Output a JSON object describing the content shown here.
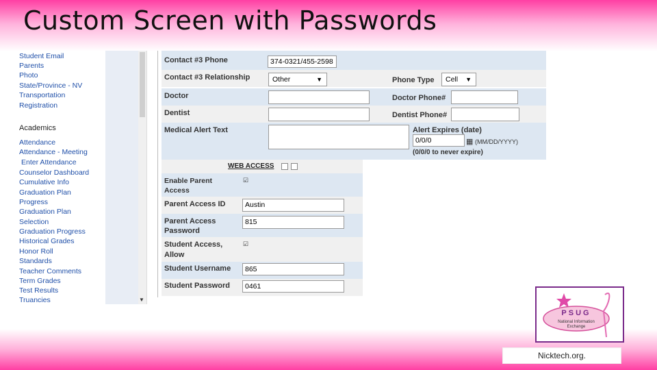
{
  "slide": {
    "title": "Custom Screen with Passwords",
    "footer": "Nicktech.org."
  },
  "nav": {
    "items_top": [
      "Student Email",
      "Parents",
      "Photo",
      "State/Province - NV",
      "Transportation",
      "Registration"
    ],
    "section": "Academics",
    "items": [
      "Attendance",
      "Attendance - Meeting",
      "Enter Attendance",
      "Counselor Dashboard",
      "Cumulative Info",
      "Graduation Plan",
      "Progress",
      "Graduation Plan",
      "Selection",
      "Graduation Progress",
      "Historical Grades",
      "Honor Roll",
      "Standards",
      "Teacher Comments",
      "Term Grades",
      "Test Results",
      "Truancies"
    ]
  },
  "form": {
    "contact3_phone": {
      "label": "Contact #3 Phone",
      "value": "374-0321/455-2598"
    },
    "contact3_rel": {
      "label": "Contact #3 Relationship",
      "value": "Other"
    },
    "phone_type": {
      "label": "Phone Type",
      "value": "Cell"
    },
    "doctor": {
      "label": "Doctor",
      "value": ""
    },
    "doctor_phone": {
      "label": "Doctor Phone#",
      "value": ""
    },
    "dentist": {
      "label": "Dentist",
      "value": ""
    },
    "dentist_phone": {
      "label": "Dentist Phone#",
      "value": ""
    },
    "medical_alert": {
      "label": "Medical Alert Text",
      "value": ""
    },
    "alert_expires": {
      "label": "Alert Expires (date)",
      "value": "0/0/0",
      "format": "(MM/DD/YYYY)",
      "hint": "(0/0/0 to never expire)"
    },
    "web_access": {
      "label": "WEB ACCESS"
    },
    "enable_parent": {
      "label1": "Enable Parent",
      "label2": "Access",
      "checked": true
    },
    "parent_id": {
      "label": "Parent Access ID",
      "value": "Austin"
    },
    "parent_pw": {
      "label1": "Parent Access",
      "label2": "Password",
      "value": "815"
    },
    "student_access": {
      "label1": "Student Access,",
      "label2": "Allow",
      "checked": true
    },
    "student_user": {
      "label": "Student Username",
      "value": "865"
    },
    "student_pw": {
      "label": "Student Password",
      "value": "0461"
    }
  },
  "logo": {
    "text": "PSUG",
    "subtitle1": "National Information",
    "subtitle2": "Exchange"
  },
  "colors": {
    "accent": "#ff3fa3",
    "row_blue": "#dde7f2",
    "row_gray": "#f0f0f0",
    "link": "#1f4fa8",
    "logo_border": "#7a2a8a"
  }
}
